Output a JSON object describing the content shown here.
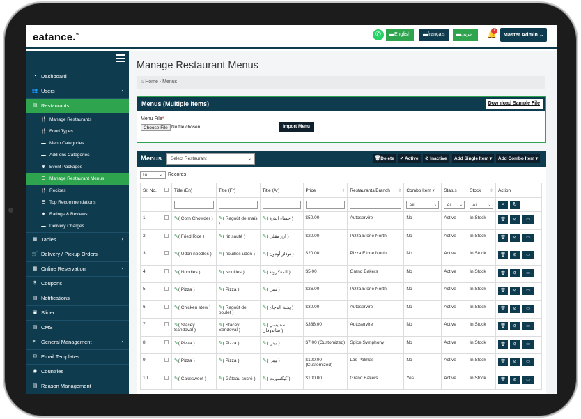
{
  "app": {
    "logo": "eatance.",
    "logo_mark": "™",
    "langs": [
      "English",
      "français",
      "عربي"
    ],
    "notifications_count": "1",
    "admin_label": "Master Admin"
  },
  "colors": {
    "primary": "#0f3b4f",
    "accent": "#2ea44f",
    "dark_button": "#0f1f2b",
    "whatsapp": "#25d366",
    "badge": "#e53935"
  },
  "sidebar": {
    "items": [
      {
        "label": "Dashboard",
        "icon": "tachometer-icon"
      },
      {
        "label": "Users",
        "icon": "users-icon",
        "arrow": "‹"
      },
      {
        "label": "Restaurants",
        "icon": "file-icon",
        "active": true
      }
    ],
    "subitems": [
      {
        "label": "Manage Restaurants",
        "icon": "cutlery-icon"
      },
      {
        "label": "Food Types",
        "icon": "cutlery-icon"
      },
      {
        "label": "Menu Categories",
        "icon": "list-icon"
      },
      {
        "label": "Add-ons Categories",
        "icon": "list-icon"
      },
      {
        "label": "Event Packages",
        "icon": "gift-icon"
      },
      {
        "label": "Manage Restaurant Menus",
        "icon": "list-icon",
        "active": true
      },
      {
        "label": "Recipes",
        "icon": "cutlery-icon"
      },
      {
        "label": "Top Recommendations",
        "icon": "list-icon"
      },
      {
        "label": "Ratings & Reviews",
        "icon": "star-icon"
      },
      {
        "label": "Delivery Charges",
        "icon": "list-icon"
      }
    ],
    "lower_items": [
      {
        "label": "Tables",
        "icon": "calendar-icon",
        "arrow": "‹"
      },
      {
        "label": "Delivery / Pickup Orders",
        "icon": "cart-icon"
      },
      {
        "label": "Online Reservation",
        "icon": "calendar-icon",
        "arrow": "‹"
      },
      {
        "label": "Coupons",
        "icon": "dollar-icon"
      },
      {
        "label": "Notifications",
        "icon": "file-icon"
      },
      {
        "label": "Slider",
        "icon": "image-icon"
      },
      {
        "label": "CMS",
        "icon": "file-icon"
      },
      {
        "label": "General Management",
        "icon": "sliders-icon",
        "arrow": "‹"
      },
      {
        "label": "Email Templates",
        "icon": "envelope-icon"
      },
      {
        "label": "Countries",
        "icon": "globe-icon"
      },
      {
        "label": "Reason Management",
        "icon": "file-icon"
      }
    ]
  },
  "page": {
    "title": "Manage Restaurant Menus",
    "breadcrumb_home": "Home",
    "breadcrumb_sep": "›",
    "breadcrumb_current": "Menus"
  },
  "import_panel": {
    "title": "Menus (Multiple Items)",
    "download_label": "Download Sample File",
    "file_label": "Menu File",
    "required_mark": "*",
    "choose_label": "Choose File",
    "no_file_text": "No file chosen",
    "import_label": "Import Menu"
  },
  "menus_panel": {
    "title": "Menus",
    "restaurant_select": "Select Restaurant",
    "buttons": [
      "Delete",
      "Active",
      "Inactive",
      "Add Single Item",
      "Add Combo Item"
    ],
    "records_select": "10",
    "records_label": "Records",
    "columns": [
      "Sr. No.",
      "",
      "Title (En)",
      "Title (Fr)",
      "Title (Ar)",
      "Price",
      "Restaurants/Branch",
      "Combo Item",
      "Status",
      "Stock",
      "Action"
    ],
    "filters": {
      "combo": "All",
      "status": "Al",
      "stock": "All"
    },
    "rows": [
      {
        "sr": "1",
        "en": "( Corn Chowder )",
        "fr": "( Ragoût de maïs )",
        "ar": "( حساء الذرة )",
        "price": "$50.00",
        "rest": "Autoservire",
        "combo": "No",
        "status": "Active",
        "stock": "In Stock"
      },
      {
        "sr": "2",
        "en": "( Fried Rice )",
        "fr": "( riz sauté )",
        "ar": "( أرز مقلي )",
        "price": "$20.00",
        "rest": "Pizza Eforie North",
        "combo": "No",
        "status": "Active",
        "stock": "In Stock"
      },
      {
        "sr": "3",
        "en": "( Udon noodles )",
        "fr": "( nouilles udon )",
        "ar": "( نودلز أودون )",
        "price": "$20.00",
        "rest": "Pizza Eforie North",
        "combo": "No",
        "status": "Active",
        "stock": "In Stock"
      },
      {
        "sr": "4",
        "en": "( Noodles )",
        "fr": "( Nouilles )",
        "ar": "( المعكرونة )",
        "price": "$5.00",
        "rest": "Grand Bakers",
        "combo": "No",
        "status": "Active",
        "stock": "In Stock"
      },
      {
        "sr": "5",
        "en": "( Pizza )",
        "fr": "( Pizza )",
        "ar": "( بيتزا )",
        "price": "$26.00",
        "rest": "Pizza Eforie North",
        "combo": "No",
        "status": "Active",
        "stock": "In Stock"
      },
      {
        "sr": "6",
        "en": "( Chicken stew )",
        "fr": "( Ragoût de poulet )",
        "ar": "( يخنة الدجاج )",
        "price": "$30.00",
        "rest": "Autoservire",
        "combo": "No",
        "status": "Active",
        "stock": "In Stock"
      },
      {
        "sr": "7",
        "en": "( Stacey Sandoval )",
        "fr": "( Stacey Sandoval )",
        "ar": "( ستايسي ساندوفال )",
        "price": "$388.00",
        "rest": "Autoservire",
        "combo": "No",
        "status": "Active",
        "stock": "In Stock"
      },
      {
        "sr": "8",
        "en": "( Pizza )",
        "fr": "( Pizza )",
        "ar": "( بيتزا )",
        "price": "$7.00 (Customized)",
        "rest": "Spice Symphony",
        "combo": "No",
        "status": "Active",
        "stock": "In Stock"
      },
      {
        "sr": "9",
        "en": "( Pizza )",
        "fr": "( Pizza )",
        "ar": "( بيتزا )",
        "price": "$100.00 (Customized)",
        "rest": "Las Palmas",
        "combo": "No",
        "status": "Active",
        "stock": "In Stock"
      },
      {
        "sr": "10",
        "en": "( Cakesweet )",
        "fr": "( Gâteau sucré )",
        "ar": "( كيكسويت )",
        "price": "$100.00",
        "rest": "Grand Bakers",
        "combo": "Yes",
        "status": "Active",
        "stock": "In Stock"
      }
    ]
  }
}
